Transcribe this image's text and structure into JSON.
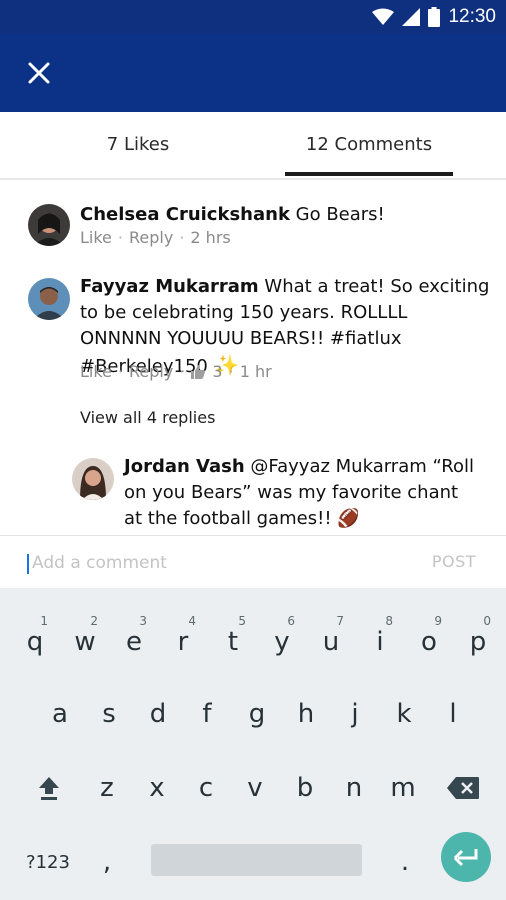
{
  "status_bar": {
    "time": "12:30"
  },
  "header": {
    "close_icon": "close-icon"
  },
  "tabs": [
    {
      "label": "7 Likes"
    },
    {
      "label": "12 Comments"
    }
  ],
  "comments": [
    {
      "author": "Chelsea Cruickshank",
      "text": " Go Bears!",
      "like_label": "Like",
      "reply_label": "Reply",
      "time": "2 hrs"
    },
    {
      "author": "Fayyaz Mukarram",
      "text": " What a treat! So exciting to be celebrating 150 years. ROLLLL ONNNNN YOUUUU BEARS!! #fiatlux #Berkeley150",
      "like_label": "Like",
      "reply_label": "Reply",
      "like_count": "3",
      "time": "1 hr",
      "view_replies": "View all 4 replies"
    }
  ],
  "reply": {
    "author": "Jordan Vash",
    "text": " @Fayyaz Mukarram “Roll on you Bears” was my favorite chant at the football games!!"
  },
  "composer": {
    "placeholder": "Add a comment",
    "post_label": "POST"
  },
  "keyboard": {
    "row1": [
      "q",
      "w",
      "e",
      "r",
      "t",
      "y",
      "u",
      "i",
      "o",
      "p"
    ],
    "row1_hints": [
      "1",
      "2",
      "3",
      "4",
      "5",
      "6",
      "7",
      "8",
      "9",
      "0"
    ],
    "row2": [
      "a",
      "s",
      "d",
      "f",
      "g",
      "h",
      "j",
      "k",
      "l"
    ],
    "row3": [
      "z",
      "x",
      "c",
      "v",
      "b",
      "n",
      "m"
    ],
    "symbols_label": "?123",
    "comma": ",",
    "period": ".",
    "enter_color": "#4db6ac"
  }
}
